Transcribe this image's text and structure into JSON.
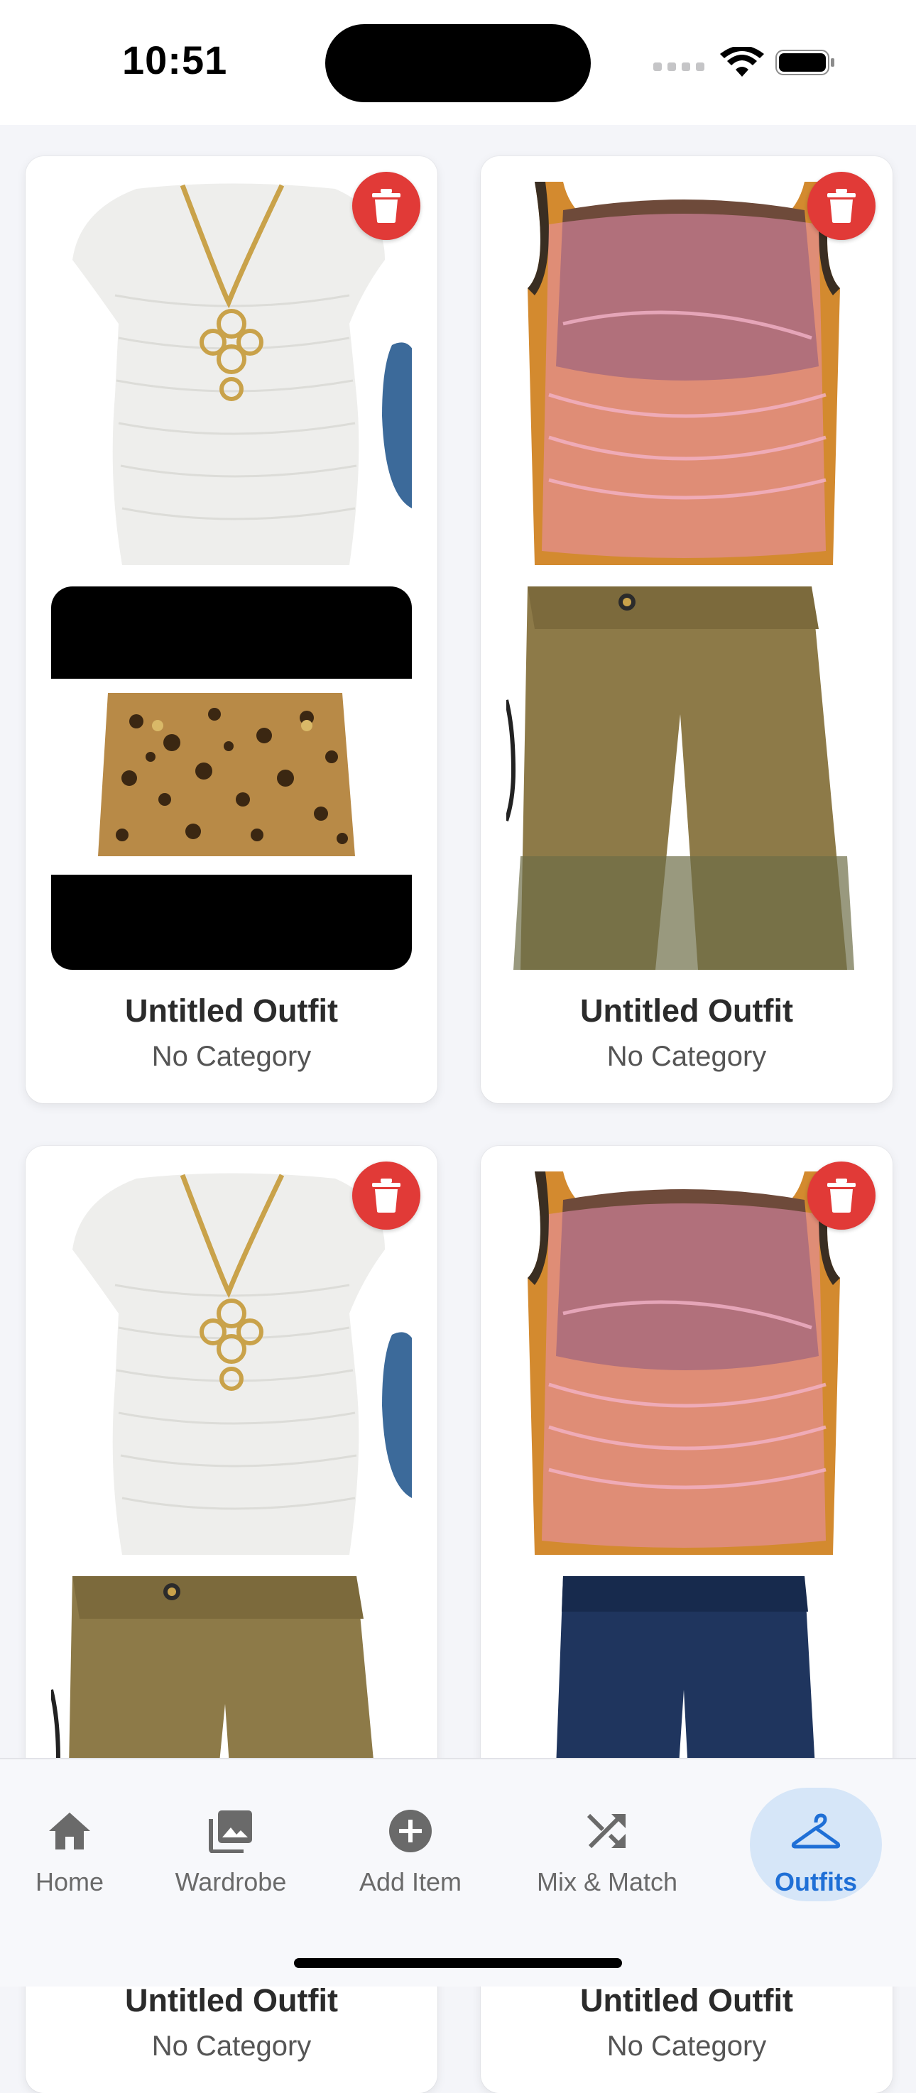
{
  "status_bar": {
    "time": "10:51"
  },
  "outfits": [
    {
      "title": "Untitled Outfit",
      "category": "No Category",
      "top_item": "white ruched top with cross necklace",
      "bottom_item": "leopard print mini skirt"
    },
    {
      "title": "Untitled Outfit",
      "category": "No Category",
      "top_item": "pink mesh tank top",
      "bottom_item": "olive washed wide-leg jeans"
    },
    {
      "title": "Untitled Outfit",
      "category": "No Category",
      "top_item": "white ruched top with cross necklace",
      "bottom_item": "olive washed wide-leg jeans"
    },
    {
      "title": "Untitled Outfit",
      "category": "No Category",
      "top_item": "pink mesh tank top",
      "bottom_item": "dark blue baggy jeans"
    }
  ],
  "tabs": [
    {
      "label": "Home",
      "icon": "home-icon"
    },
    {
      "label": "Wardrobe",
      "icon": "photo-library-icon"
    },
    {
      "label": "Add Item",
      "icon": "add-circle-icon"
    },
    {
      "label": "Mix & Match",
      "icon": "shuffle-icon"
    },
    {
      "label": "Outfits",
      "icon": "hanger-icon",
      "active": true
    }
  ],
  "colors": {
    "accent": "#1f6fd6",
    "active_pill": "#d6e6f8",
    "delete": "#e13a37"
  }
}
